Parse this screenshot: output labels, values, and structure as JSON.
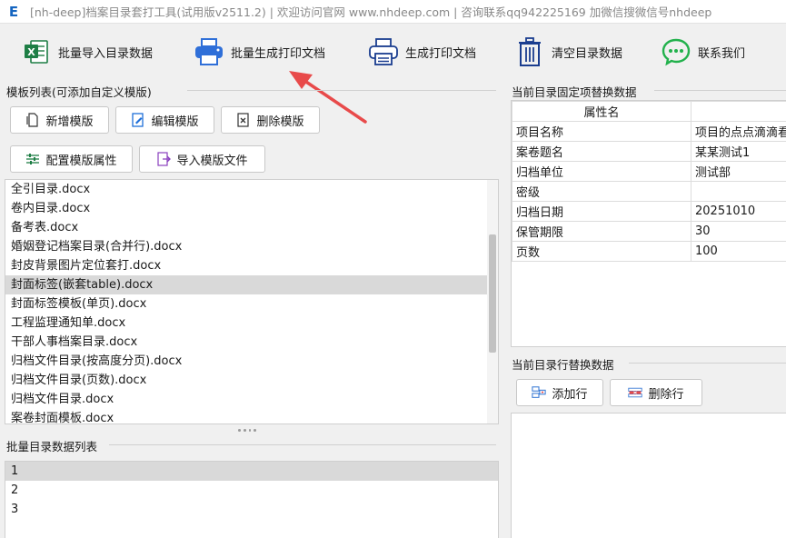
{
  "window": {
    "app_icon": "E",
    "title": "[nh-deep]档案目录套打工具(试用版v2511.2) | 欢迎访问官网 www.nhdeep.com | 咨询联系qq942225169 加微信搜微信号nhdeep"
  },
  "toolbar": {
    "import_label": "批量导入目录数据",
    "batch_print_label": "批量生成打印文档",
    "print_label": "生成打印文档",
    "clear_label": "清空目录数据",
    "contact_label": "联系我们"
  },
  "template_panel": {
    "title": "模板列表(可添加自定义模版)",
    "new_label": "新增模版",
    "edit_label": "编辑模版",
    "delete_label": "删除模版",
    "config_label": "配置模版属性",
    "import_label": "导入模版文件",
    "items": [
      "全引目录.docx",
      "卷内目录.docx",
      "备考表.docx",
      "婚姻登记档案目录(合并行).docx",
      "封皮背景图片定位套打.docx",
      "封面标签(嵌套table).docx",
      "封面标签模板(单页).docx",
      "工程监理通知单.docx",
      "干部人事档案目录.docx",
      "归档文件目录(按高度分页).docx",
      "归档文件目录(页数).docx",
      "归档文件目录.docx",
      "案卷封面模板.docx"
    ],
    "selected_index": 5
  },
  "batch_panel": {
    "title": "批量目录数据列表",
    "items": [
      "1",
      "2",
      "3"
    ],
    "selected_index": 0
  },
  "fixed_panel": {
    "title": "当前目录固定项替换数据",
    "header_name": "属性名",
    "header_value": "",
    "rows": [
      {
        "name": "项目名称",
        "value": "项目的点点滴滴看"
      },
      {
        "name": "案卷题名",
        "value": "某某测试1"
      },
      {
        "name": "归档单位",
        "value": "测试部"
      },
      {
        "name": "密级",
        "value": ""
      },
      {
        "name": "归档日期",
        "value": "20251010"
      },
      {
        "name": "保管期限",
        "value": "30"
      },
      {
        "name": "页数",
        "value": "100"
      }
    ]
  },
  "row_panel": {
    "title": "当前目录行替换数据",
    "add_label": "添加行",
    "delete_label": "删除行"
  },
  "colors": {
    "accent_red": "#e84a4a",
    "excel_green": "#1e7e45",
    "printer_blue": "#2f6fd8",
    "trash_blue": "#1a3d8f",
    "wechat_green": "#22b14c",
    "selection_gray": "#d9d9d9"
  }
}
